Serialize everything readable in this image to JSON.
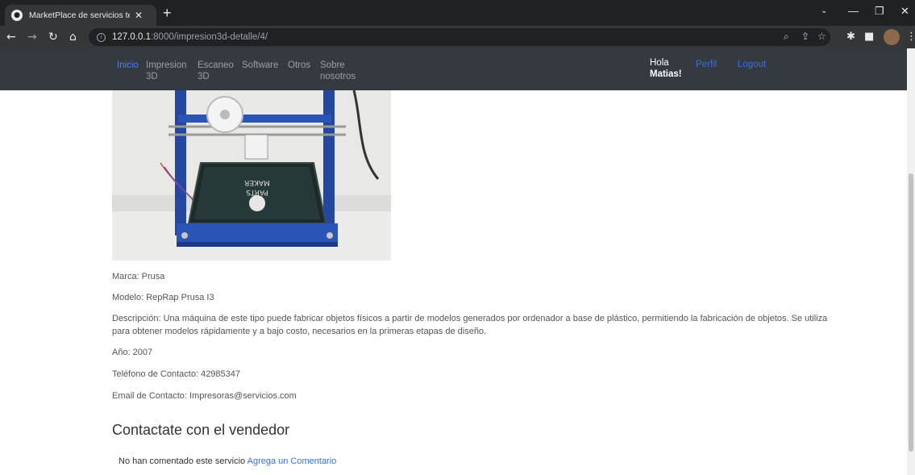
{
  "browser": {
    "tab_title": "MarketPlace de servicios tecnoló",
    "url_host": "127.0.0.1",
    "url_rest": ":8000/impresion3d-detalle/4/"
  },
  "navbar": {
    "items": [
      {
        "line1": "Inicio",
        "line2": ""
      },
      {
        "line1": "Impresion",
        "line2": "3D"
      },
      {
        "line1": "Escaneo",
        "line2": "3D"
      },
      {
        "line1": "Software",
        "line2": ""
      },
      {
        "line1": "Otros",
        "line2": ""
      },
      {
        "line1": "Sobre",
        "line2": "nosotros"
      }
    ],
    "greeting": "Hola",
    "username": "Matias!",
    "profile": "Perfil",
    "logout": "Logout"
  },
  "product": {
    "image_label_1": "MAKER",
    "image_label_2": "PARTS",
    "marca": "Marca: Prusa",
    "modelo": "Modelo: RepRap Prusa I3",
    "descripcion": "Descripción: Una máquina de este tipo puede fabricar objetos físicos a partir de modelos generados por ordenador a base de plástico, permitiendo la fabricación de objetos. Se utiliza para obtener modelos rápidamente y a bajo costo, necesarios en la primeras etapas de diseño.",
    "anio": "Año: 2007",
    "telefono": "Teléfono de Contacto: 42985347",
    "email": "Email de Contacto: Impresoras@servicios.com"
  },
  "contact": {
    "title": "Contactate con el vendedor",
    "no_comments": "No han comentado este servicio",
    "add_comment": "Agrega un Comentario"
  },
  "colors": {
    "navbar_bg": "#343a40",
    "link_blue": "#3b6fe0",
    "active_blue": "#4c7df0"
  }
}
